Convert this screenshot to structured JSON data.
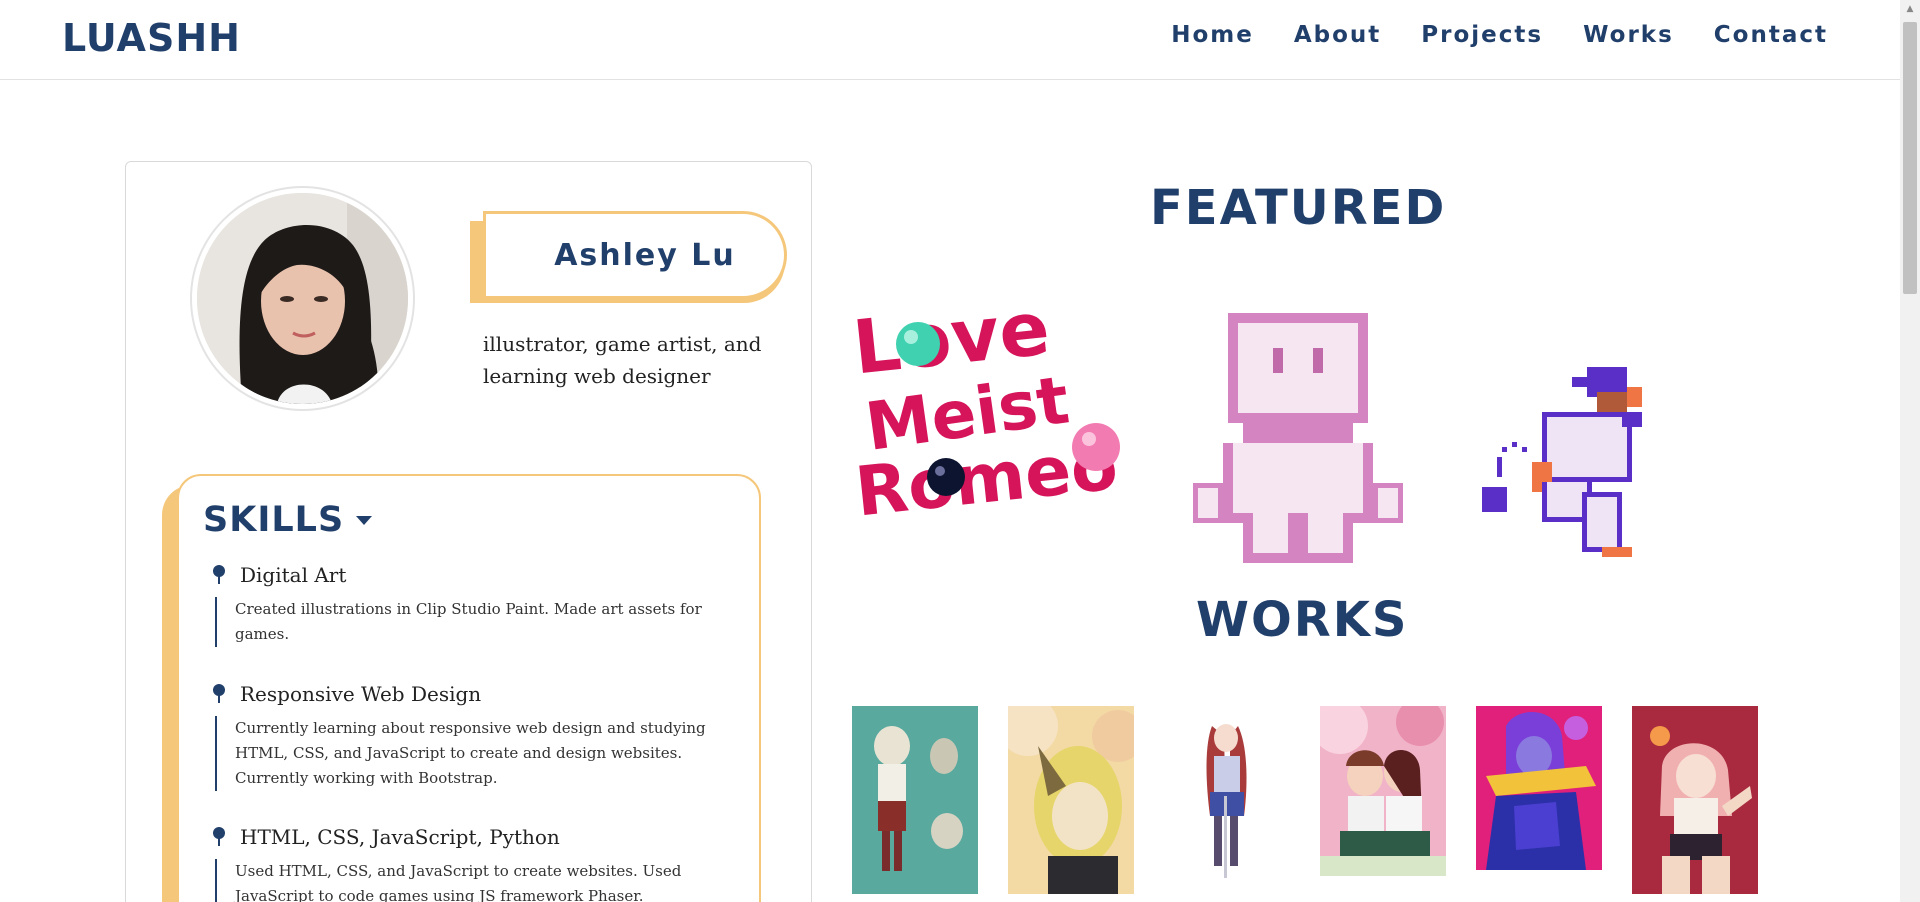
{
  "nav": {
    "brand": "LUASHH",
    "links": [
      "Home",
      "About",
      "Projects",
      "Works",
      "Contact"
    ]
  },
  "profile": {
    "name": "Ashley Lu",
    "tagline": "illustrator, game artist, and learning web designer"
  },
  "skills": {
    "title": "SKILLS",
    "items": [
      {
        "title": "Digital Art",
        "desc": "Created illustrations in Clip Studio Paint. Made art assets for games."
      },
      {
        "title": "Responsive Web Design",
        "desc": "Currently learning about responsive web design and studying HTML, CSS, and JavaScript to create and design websites. Currently working with Bootstrap."
      },
      {
        "title": "HTML, CSS, JavaScript, Python",
        "desc": "Used HTML, CSS, and JavaScript to create websites. Used JavaScript to code games using JS framework Phaser."
      }
    ]
  },
  "featured": {
    "title": "FEATURED",
    "logo_lines": [
      "Love",
      "Meist",
      "Romeo"
    ]
  },
  "works": {
    "title": "WORKS"
  },
  "colors": {
    "navy": "#213f6b",
    "accent_yellow": "#f5c77a",
    "logo_pink": "#d6145a"
  }
}
